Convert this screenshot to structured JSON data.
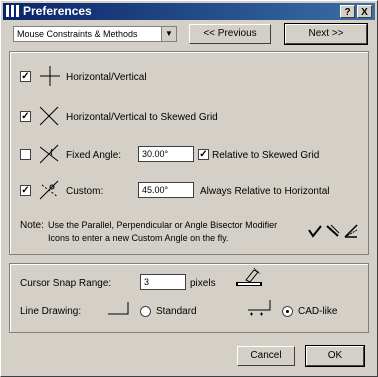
{
  "window": {
    "title": "Preferences",
    "help_label": "?",
    "close_label": "X"
  },
  "top": {
    "dropdown_value": "Mouse Constraints & Methods",
    "previous_label": "<< Previous",
    "next_label": "Next >>"
  },
  "constraints": {
    "horizontal_vertical": {
      "checked": true,
      "label": "Horizontal/Vertical"
    },
    "skewed_grid": {
      "checked": true,
      "label": "Horizontal/Vertical to Skewed Grid"
    },
    "fixed_angle": {
      "checked": false,
      "label": "Fixed Angle:",
      "value": "30.00°",
      "relative_checked": true,
      "relative_label": "Relative to Skewed Grid"
    },
    "custom": {
      "checked": true,
      "label": "Custom:",
      "value": "45.00°",
      "always_label": "Always Relative to Horizontal"
    },
    "note_label": "Note:",
    "note_line1": "Use the Parallel, Perpendicular or Angle Bisector Modifier",
    "note_line2": "Icons to enter a new Custom Angle on the fly."
  },
  "snap": {
    "label": "Cursor Snap Range:",
    "value": "3",
    "unit": "pixels"
  },
  "line_drawing": {
    "label": "Line Drawing:",
    "standard_label": "Standard",
    "cadlike_label": "CAD-like",
    "selected": "cadlike"
  },
  "footer": {
    "cancel_label": "Cancel",
    "ok_label": "OK"
  }
}
